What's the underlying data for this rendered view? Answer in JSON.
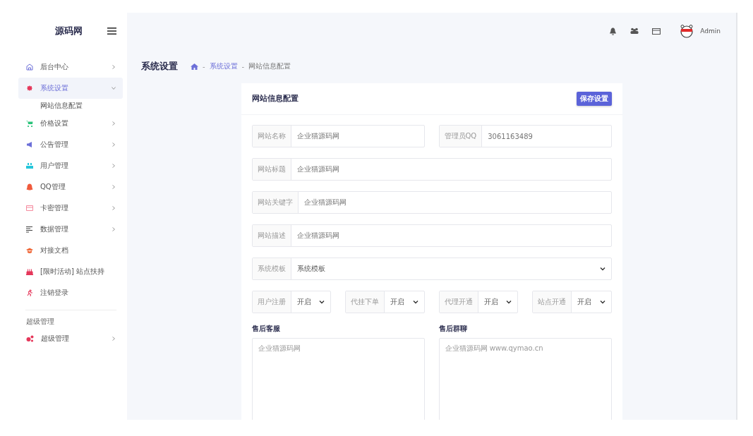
{
  "logo": {
    "text": "源码网"
  },
  "sidebar": {
    "items": [
      {
        "label": "后台中心",
        "selected": false,
        "chevron": true,
        "expanded": false
      },
      {
        "label": "系统设置",
        "selected": true,
        "chevron": true,
        "expanded": true,
        "children": [
          {
            "label": "网站信息配置"
          }
        ]
      },
      {
        "label": "价格设置",
        "selected": false,
        "chevron": true,
        "expanded": false
      },
      {
        "label": "公告管理",
        "selected": false,
        "chevron": true,
        "expanded": false
      },
      {
        "label": "用户管理",
        "selected": false,
        "chevron": true,
        "expanded": false
      },
      {
        "label": "QQ管理",
        "selected": false,
        "chevron": true,
        "expanded": false
      },
      {
        "label": "卡密管理",
        "selected": false,
        "chevron": true,
        "expanded": false
      },
      {
        "label": "数据管理",
        "selected": false,
        "chevron": true,
        "expanded": false
      },
      {
        "label": "对接文档",
        "selected": false,
        "chevron": false
      },
      {
        "label": "[限时活动] 站点扶持",
        "selected": false,
        "chevron": false
      },
      {
        "label": "注销登录",
        "selected": false,
        "chevron": false
      }
    ],
    "section": {
      "heading": "超级管理",
      "items": [
        {
          "label": "超级管理",
          "selected": false,
          "chevron": true,
          "expanded": false
        }
      ]
    }
  },
  "header": {
    "user": "Admin"
  },
  "page": {
    "title": "系统设置",
    "separators": [
      "-",
      "-"
    ],
    "breadcrumb": [
      {
        "label": "系统设置",
        "link": true
      },
      {
        "label": "网站信息配置",
        "link": false
      }
    ]
  },
  "card": {
    "title": "网站信息配置",
    "save_button": "保存设置",
    "fields": [
      {
        "kind": "input",
        "label": "网站名称",
        "value": "企业猫源码网"
      },
      {
        "kind": "input",
        "label": "管理员QQ",
        "value": "3061163489"
      },
      {
        "kind": "input",
        "label": "网站标题",
        "value": "企业猫源码网"
      },
      {
        "kind": "input",
        "label": "网站关键字",
        "value": "企业猫源码网"
      },
      {
        "kind": "input",
        "label": "网站描述",
        "value": "企业猫源码网"
      },
      {
        "kind": "select",
        "label": "系统模板",
        "value": "系统模板"
      },
      {
        "kind": "select",
        "label": "用户注册",
        "value": "开启"
      },
      {
        "kind": "select",
        "label": "代挂下单",
        "value": "开启"
      },
      {
        "kind": "select",
        "label": "代理开通",
        "value": "开启"
      },
      {
        "kind": "select",
        "label": "站点开通",
        "value": "开启"
      }
    ],
    "textareas": [
      {
        "label": "售后客服",
        "value": "企业猫源码网"
      },
      {
        "label": "售后群聊",
        "value": "企业猫源码网 www.qymao.cn"
      }
    ]
  }
}
